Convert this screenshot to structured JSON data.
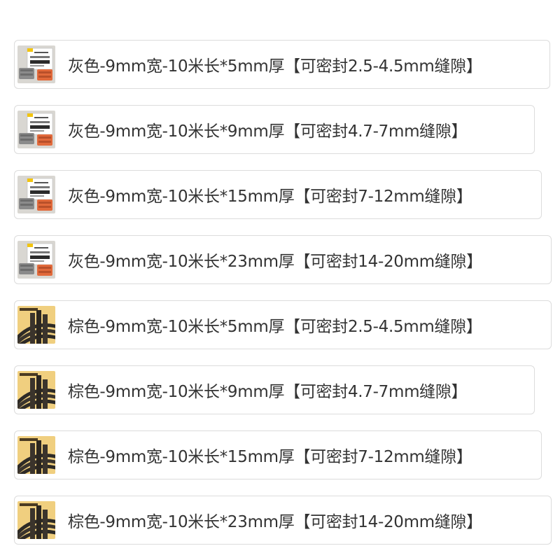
{
  "options": [
    {
      "label": "灰色-9mm宽-10米长*5mm厚【可密封2.5-4.5mm缝隙】",
      "thumb": "gray-seal-strip-package-thumbnail"
    },
    {
      "label": "灰色-9mm宽-10米长*9mm厚【可密封4.7-7mm缝隙】",
      "thumb": "gray-seal-strip-package-thumbnail"
    },
    {
      "label": "灰色-9mm宽-10米长*15mm厚【可密封7-12mm缝隙】",
      "thumb": "gray-seal-strip-package-thumbnail"
    },
    {
      "label": "灰色-9mm宽-10米长*23mm厚【可密封14-20mm缝隙】",
      "thumb": "gray-seal-strip-package-thumbnail"
    },
    {
      "label": "棕色-9mm宽-10米长*5mm厚【可密封2.5-4.5mm缝隙】",
      "thumb": "brown-seal-strip-roll-thumbnail"
    },
    {
      "label": "棕色-9mm宽-10米长*9mm厚【可密封4.7-7mm缝隙】",
      "thumb": "brown-seal-strip-roll-thumbnail"
    },
    {
      "label": "棕色-9mm宽-10米长*15mm厚【可密封7-12mm缝隙】",
      "thumb": "brown-seal-strip-roll-thumbnail"
    },
    {
      "label": "棕色-9mm宽-10米长*23mm厚【可密封14-20mm缝隙】",
      "thumb": "brown-seal-strip-roll-thumbnail"
    }
  ]
}
